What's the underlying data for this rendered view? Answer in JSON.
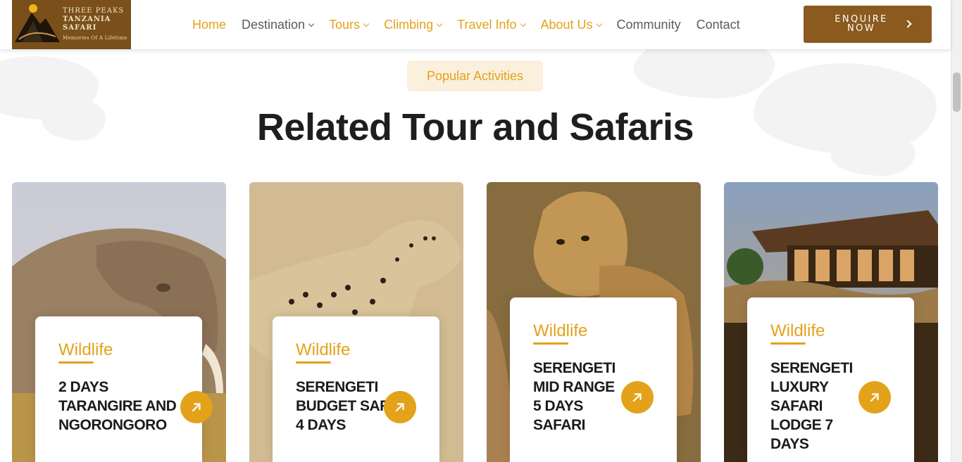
{
  "brand": {
    "name_line1": "THREE PEAKS",
    "name_line2": "TANZANIA",
    "name_line3": "SAFARI",
    "tagline": "Memories Of A Lifetime",
    "color": "#7a4f1a"
  },
  "nav": {
    "items": [
      {
        "label": "Home",
        "has_dropdown": false,
        "color": "gold"
      },
      {
        "label": "Destination",
        "has_dropdown": true,
        "color": "grey"
      },
      {
        "label": "Tours",
        "has_dropdown": true,
        "color": "gold"
      },
      {
        "label": "Climbing",
        "has_dropdown": true,
        "color": "gold"
      },
      {
        "label": "Travel Info",
        "has_dropdown": true,
        "color": "gold"
      },
      {
        "label": "About Us",
        "has_dropdown": true,
        "color": "gold"
      },
      {
        "label": "Community",
        "has_dropdown": false,
        "color": "grey"
      },
      {
        "label": "Contact",
        "has_dropdown": false,
        "color": "grey"
      }
    ],
    "cta_label": "ENQUIRE NOW",
    "cta_icon": "chevron-right-icon"
  },
  "section": {
    "badge": "Popular Activities",
    "title": "Related Tour and Safaris"
  },
  "tours": [
    {
      "category": "Wildlife",
      "name": "2 DAYS TARANGIRE AND NGORONGORO",
      "image": "elephant-photo",
      "action_icon": "arrow-up-right-icon"
    },
    {
      "category": "Wildlife",
      "name": "SERENGETI BUDGET SAFARI 4 DAYS",
      "image": "leopard-photo",
      "action_icon": "arrow-up-right-icon"
    },
    {
      "category": "Wildlife",
      "name": "SERENGETI MID RANGE 5 DAYS SAFARI",
      "image": "lion-cub-photo",
      "action_icon": "arrow-up-right-icon"
    },
    {
      "category": "Wildlife",
      "name": "SERENGETI LUXURY SAFARI LODGE 7 DAYS",
      "image": "safari-lodge-photo",
      "action_icon": "arrow-up-right-icon"
    }
  ],
  "colors": {
    "accent": "#e3a21a",
    "cta_bg": "#8a5a1e",
    "badge_bg": "#fbf0de",
    "text_dark": "#1e1e1e",
    "nav_grey": "#5c5c5c"
  }
}
